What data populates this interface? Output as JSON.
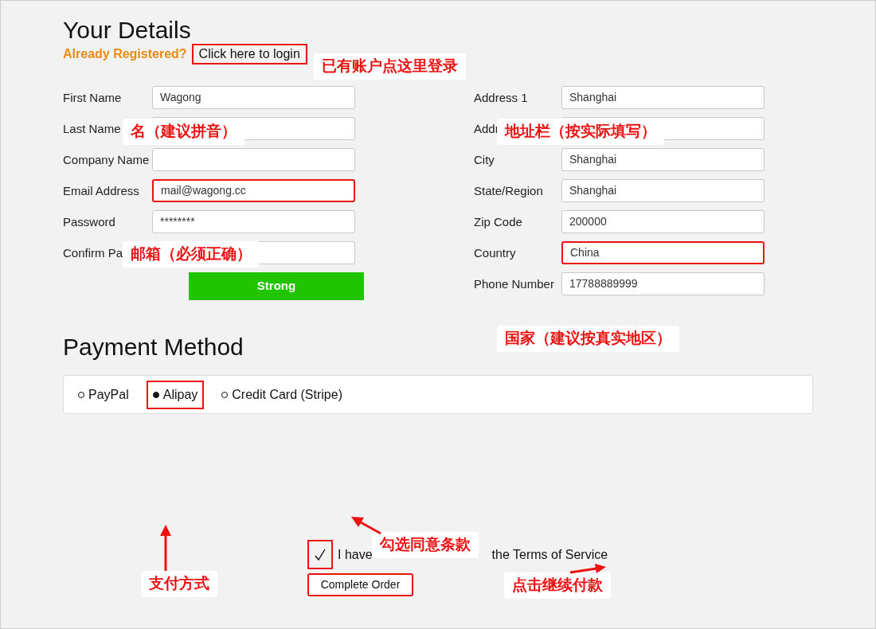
{
  "header": {
    "title": "Your Details",
    "prompt": "Already Registered?",
    "login_link": {
      "label": "Click here to login",
      "highlighted": true
    }
  },
  "left_fields": [
    {
      "label": "First Name",
      "value": "Wagong",
      "highlighted": false
    },
    {
      "label": "Last Name",
      "highlighted": false
    },
    {
      "label": "Company Name",
      "highlighted": false
    },
    {
      "label": "Email Address",
      "value": "mail@wagong.cc",
      "highlighted": true
    },
    {
      "label": "Password",
      "value": "********",
      "highlighted": false
    },
    {
      "label": "Confirm Pa",
      "highlighted": false
    }
  ],
  "password_strength": {
    "label": "Strong"
  },
  "right_fields": [
    {
      "label": "Address 1",
      "value": "Shanghai",
      "highlighted": false
    },
    {
      "label": "Addr",
      "highlighted": false
    },
    {
      "label": "City",
      "value": "Shanghai",
      "highlighted": false
    },
    {
      "label": "State/Region",
      "value": "Shanghai",
      "highlighted": false
    },
    {
      "label": "Zip Code",
      "value": "200000",
      "highlighted": false
    },
    {
      "label": "Country",
      "value": "China",
      "highlighted": true
    },
    {
      "label": "Phone Number",
      "value": "17788889999",
      "highlighted": false
    }
  ],
  "payment": {
    "title": "Payment Method",
    "options": [
      {
        "label": "PayPal",
        "selected": false,
        "highlighted": false
      },
      {
        "label": "Alipay",
        "selected": true,
        "highlighted": true
      },
      {
        "label": "Credit Card (Stripe)",
        "selected": false,
        "highlighted": false
      }
    ]
  },
  "agreement": {
    "checked": true,
    "highlighted": true,
    "text_before": "I have",
    "text_after": "the Terms of Service"
  },
  "submit": {
    "label": "Complete Order",
    "highlighted": true
  },
  "annotations": [
    {
      "text": "已有账户点这里登录"
    },
    {
      "text": "名（建议拼音）"
    },
    {
      "text": "地址栏（按实际填写）"
    },
    {
      "text": "邮箱（必须正确）"
    },
    {
      "text": "国家（建议按真实地区）"
    },
    {
      "text": "勾选同意条款"
    },
    {
      "text": "支付方式"
    },
    {
      "text": "点击继续付款"
    }
  ]
}
